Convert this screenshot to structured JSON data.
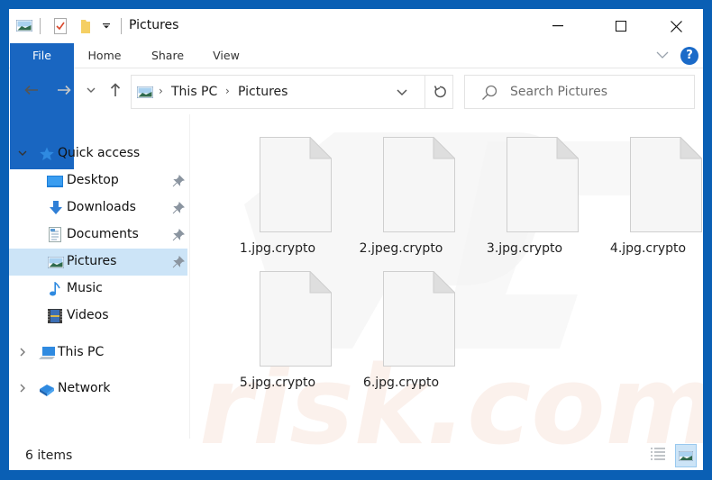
{
  "window": {
    "title": "Pictures",
    "controls": {
      "minimize": "–",
      "maximize": "☐",
      "close": "✕"
    }
  },
  "quick_access_toolbar": {
    "icons": [
      "pictures-icon",
      "properties-icon",
      "new-folder-icon",
      "customize-dropdown-icon"
    ]
  },
  "ribbon": {
    "tabs": [
      {
        "label": "File",
        "active": true
      },
      {
        "label": "Home"
      },
      {
        "label": "Share"
      },
      {
        "label": "View"
      }
    ],
    "help_label": "?"
  },
  "address_bar": {
    "breadcrumb": [
      "This PC",
      "Pictures"
    ],
    "separator": "›"
  },
  "search": {
    "placeholder": "Search Pictures"
  },
  "nav_pane": {
    "items": [
      {
        "label": "Quick access",
        "icon": "star-icon",
        "expanded": true,
        "level": 0
      },
      {
        "label": "Desktop",
        "icon": "desktop-icon",
        "pinned": true,
        "level": 1
      },
      {
        "label": "Downloads",
        "icon": "download-icon",
        "pinned": true,
        "level": 1
      },
      {
        "label": "Documents",
        "icon": "documents-icon",
        "pinned": true,
        "level": 1
      },
      {
        "label": "Pictures",
        "icon": "pictures-icon",
        "pinned": true,
        "level": 1,
        "selected": true
      },
      {
        "label": "Music",
        "icon": "music-icon",
        "level": 1
      },
      {
        "label": "Videos",
        "icon": "videos-icon",
        "level": 1
      },
      {
        "label": "This PC",
        "icon": "computer-icon",
        "expanded": false,
        "level": 0
      },
      {
        "label": "Network",
        "icon": "network-icon",
        "expanded": false,
        "level": 0
      }
    ]
  },
  "files": [
    {
      "name": "1.jpg.crypto"
    },
    {
      "name": "2.jpeg.crypto"
    },
    {
      "name": "3.jpg.crypto"
    },
    {
      "name": "4.jpg.crypto"
    },
    {
      "name": "5.jpg.crypto"
    },
    {
      "name": "6.jpg.crypto"
    }
  ],
  "status_bar": {
    "item_count": "6 items",
    "view_modes": [
      "details-view",
      "large-icons-view"
    ],
    "active_view": "large-icons-view"
  },
  "colors": {
    "frame": "#0a5fb4",
    "file_tab": "#1966c1",
    "selection": "#cce4f7",
    "help": "#1a6ac8"
  }
}
